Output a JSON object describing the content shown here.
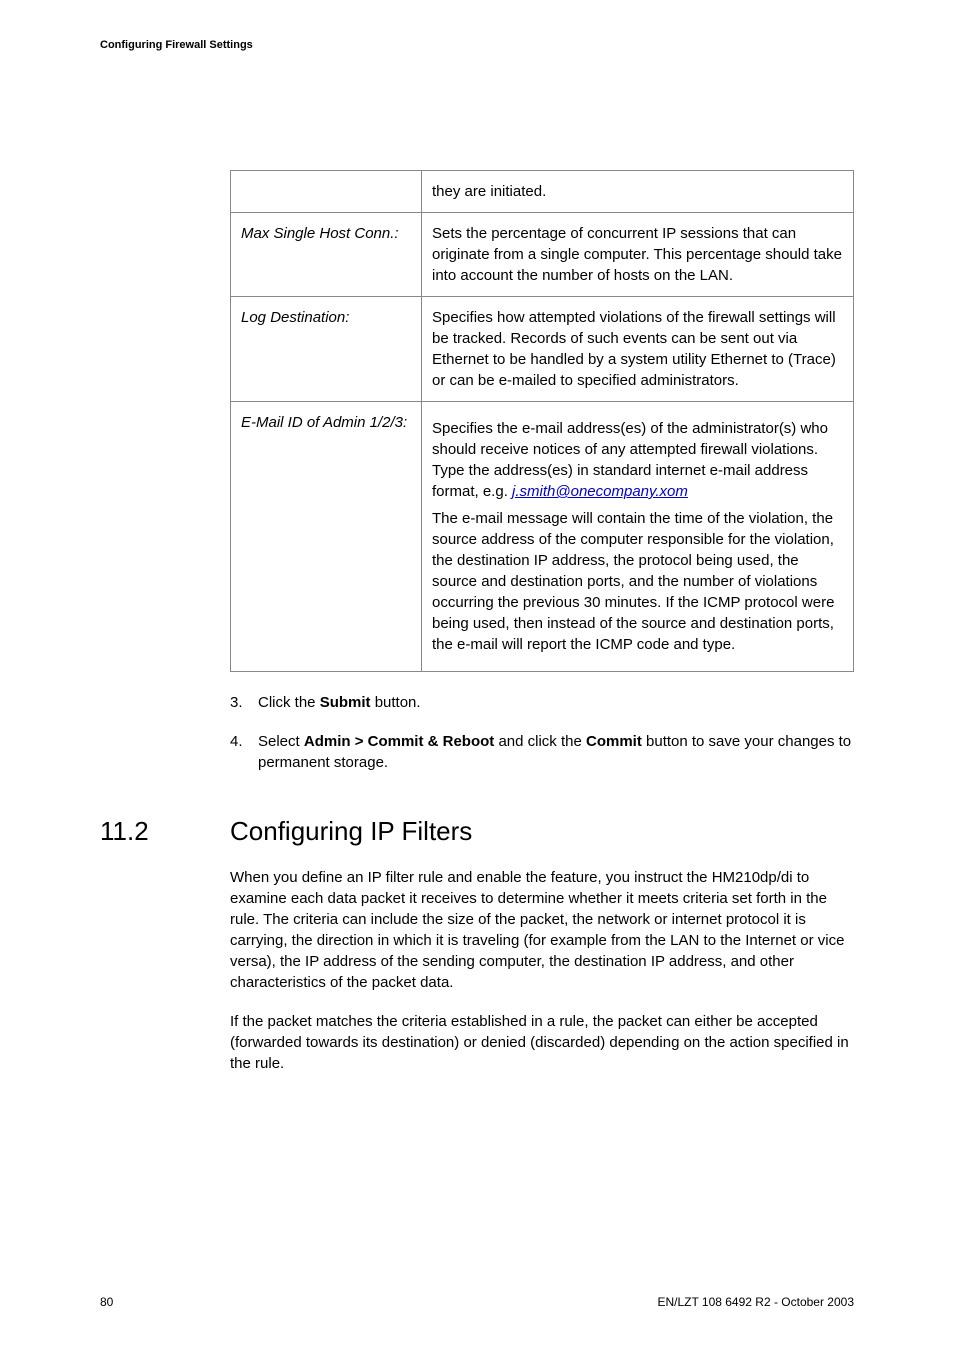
{
  "header": {
    "running": "Configuring Firewall Settings"
  },
  "table": {
    "rows": [
      {
        "label": "",
        "desc_plain": "they are initiated."
      },
      {
        "label": "Max Single Host Conn.:",
        "desc_plain": "Sets the percentage of concurrent IP sessions that can originate from a single computer. This percentage should take into account the number of hosts on the LAN."
      },
      {
        "label": "Log Destination:",
        "desc_plain": "Specifies how attempted violations of the firewall settings will be tracked. Records of such events can be sent out via Ethernet to be handled by a system utility Ethernet to (Trace) or can be e-mailed to specified administrators."
      },
      {
        "label": "E-Mail ID of Admin 1/2/3:",
        "email_pre": "Specifies the e-mail address(es) of the administrator(s) who should receive notices of any attempted firewall violations. Type the address(es) in standard internet e-mail address format, e.g. ",
        "email_link": "j.smith@onecompany.xom",
        "email_para2": "The e-mail message will contain the time of the violation, the source address of the computer responsible for the violation, the destination IP address, the protocol being used, the source and destination ports, and the number of violations occurring the previous 30 minutes. If the ICMP protocol were being used, then instead of the source and destination ports, the e-mail will report the ICMP code and type."
      }
    ]
  },
  "steps": [
    {
      "num": "3.",
      "pre": "Click the ",
      "bold1": "Submit",
      "post": " button."
    },
    {
      "num": "4.",
      "pre": "Select ",
      "bold1": "Admin > Commit & Reboot",
      "mid": " and click the ",
      "bold2": "Commit",
      "post": " button to save your changes to permanent storage."
    }
  ],
  "section": {
    "number": "11.2",
    "title": "Configuring IP Filters",
    "para1": "When you define an IP filter rule and enable the feature, you instruct the HM210dp/di to examine each data packet it receives to determine whether it meets criteria set forth in the rule. The criteria can include the size of the packet, the network or internet protocol it is carrying, the direction in which it is traveling (for example from the LAN to the Internet or vice versa), the IP address of the sending computer, the destination IP address, and other characteristics of the packet data.",
    "para2": "If the packet matches the criteria established in a rule, the packet can either be accepted (forwarded towards its destination) or denied (discarded) depending on the action specified in the rule."
  },
  "footer": {
    "page": "80",
    "doc": "EN/LZT 108 6492 R2  - October 2003"
  }
}
